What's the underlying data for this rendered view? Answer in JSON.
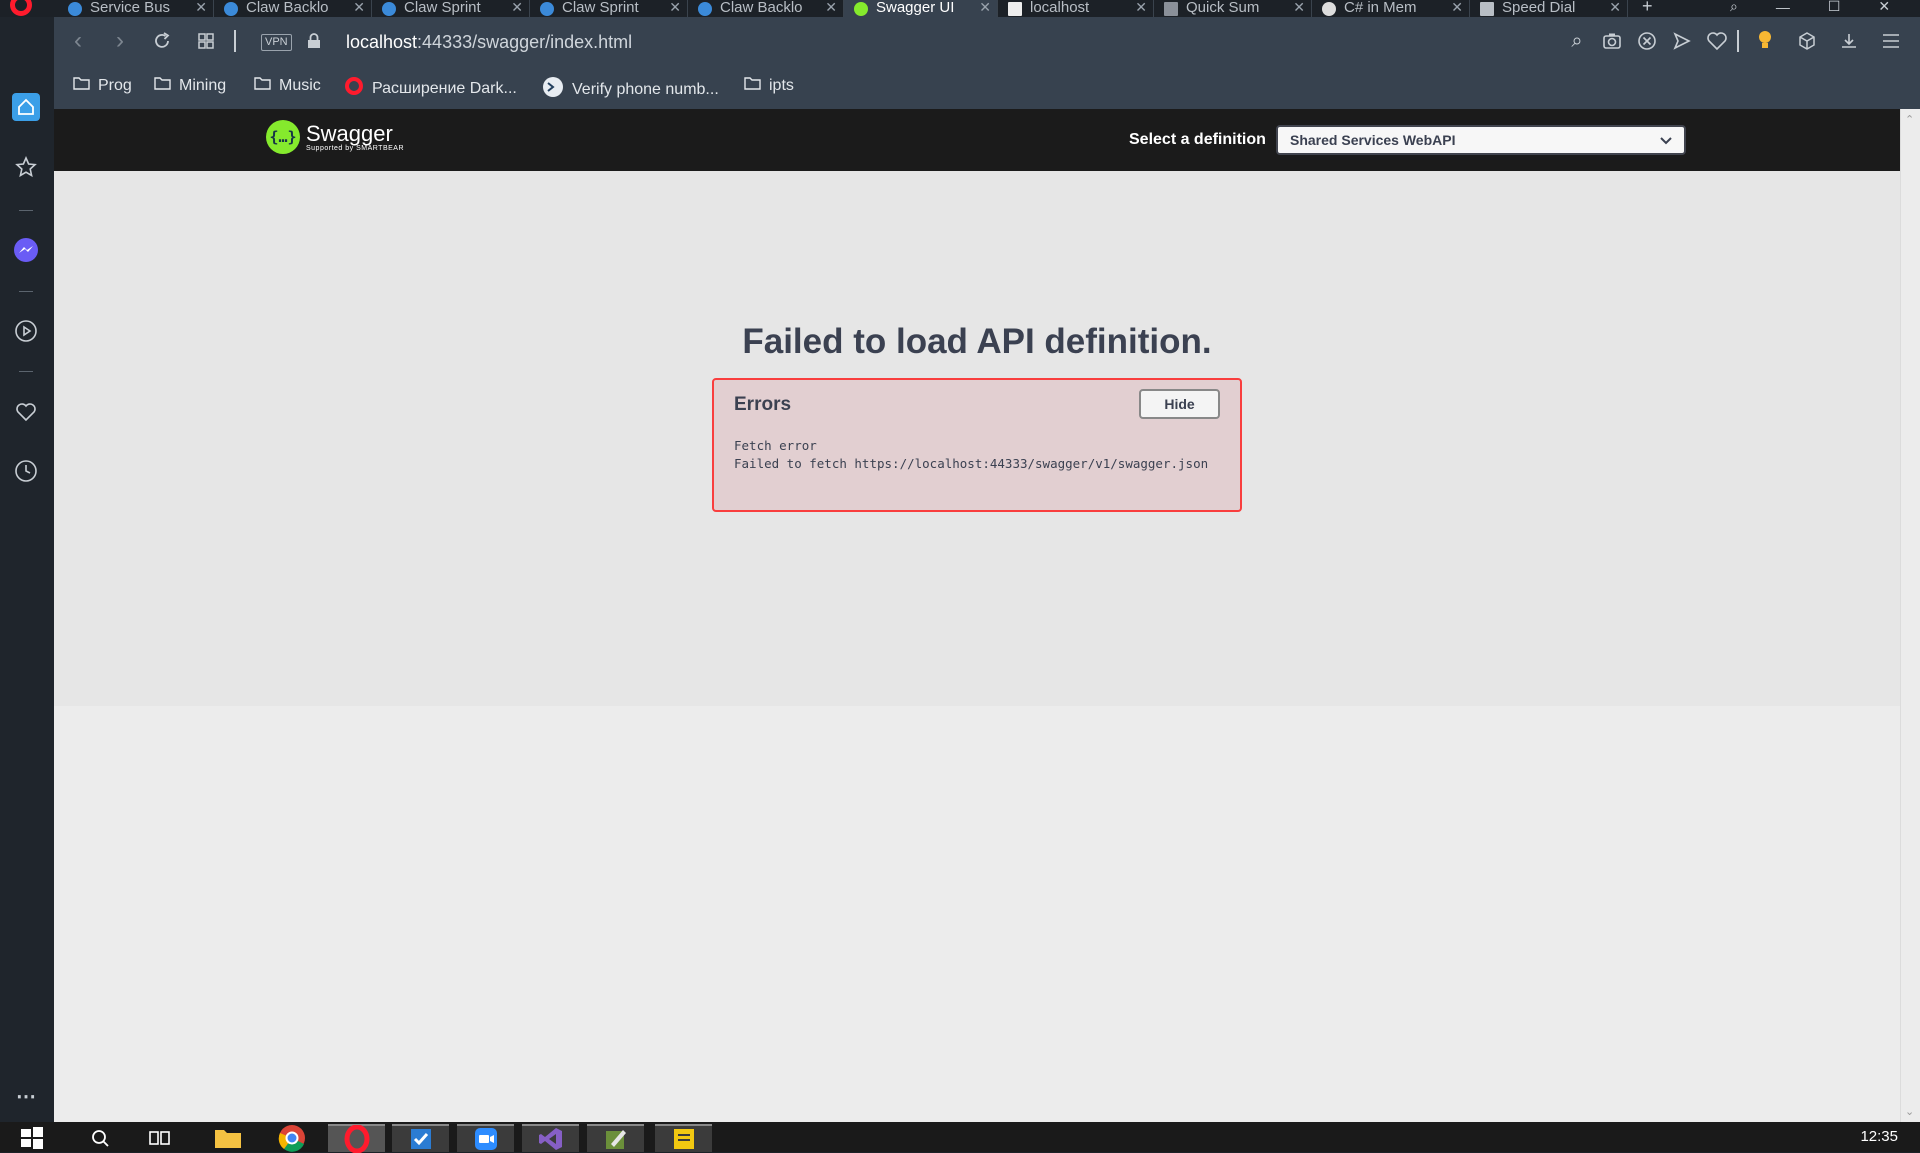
{
  "browser": {
    "tabs": [
      {
        "title": "Service Bus",
        "active": false
      },
      {
        "title": "Claw Backlo",
        "active": false
      },
      {
        "title": "Claw Sprint",
        "active": false
      },
      {
        "title": "Claw Sprint",
        "active": false
      },
      {
        "title": "Claw Backlo",
        "active": false
      },
      {
        "title": "Swagger UI",
        "active": true
      },
      {
        "title": "localhost",
        "active": false
      },
      {
        "title": "Quick Sum",
        "active": false
      },
      {
        "title": "C# in Mem",
        "active": false
      },
      {
        "title": "Speed Dial",
        "active": false
      }
    ],
    "new_tab_symbol": "+",
    "address": {
      "host": "localhost",
      "rest": ":44333/swagger/index.html"
    },
    "vpn_label": "VPN",
    "bookmarks": [
      "Prog",
      "Mining",
      "Music",
      "Расширение Dark...",
      "Verify phone numb...",
      "ipts"
    ]
  },
  "swagger": {
    "brand": "Swagger",
    "brand_sub": "Supported by SMARTBEAR",
    "select_label": "Select a definition",
    "selected_definition": "Shared Services WebAPI",
    "fail_title": "Failed to load API definition.",
    "errors_heading": "Errors",
    "hide_button": "Hide",
    "error_line1": "Fetch error",
    "error_line2": "Failed to fetch https://localhost:44333/swagger/v1/swagger.json"
  },
  "taskbar": {
    "clock": "12:35"
  },
  "colors": {
    "swagger_green": "#85ea2d",
    "error_border": "#f93e3e",
    "error_bg": "#e2cfd1",
    "toolbar": "#37424f"
  }
}
